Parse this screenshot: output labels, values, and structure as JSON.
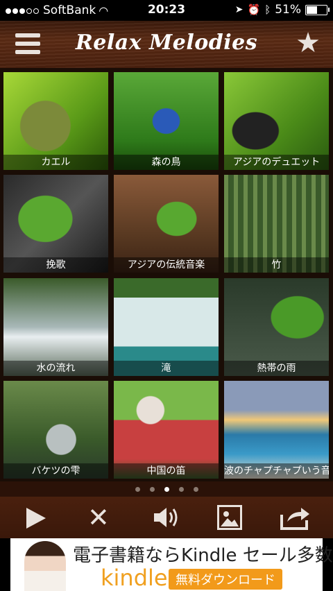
{
  "status": {
    "carrier": "SoftBank",
    "time": "20:23",
    "battery": "51%"
  },
  "header": {
    "title": "Relax Melodies"
  },
  "tiles": [
    {
      "label": "カエル"
    },
    {
      "label": "森の鳥"
    },
    {
      "label": "アジアのデュエット"
    },
    {
      "label": "挽歌"
    },
    {
      "label": "アジアの伝統音楽"
    },
    {
      "label": "竹"
    },
    {
      "label": "水の流れ"
    },
    {
      "label": "滝"
    },
    {
      "label": "熱帯の雨"
    },
    {
      "label": "バケツの雫"
    },
    {
      "label": "中国の笛"
    },
    {
      "label": "波のチャプチャプいう音"
    }
  ],
  "pager": {
    "pages": 5,
    "current": 3
  },
  "ad": {
    "line1": "電子書籍ならKindle セール多数",
    "brand": "kindle",
    "cta": "無料ダウンロード"
  }
}
